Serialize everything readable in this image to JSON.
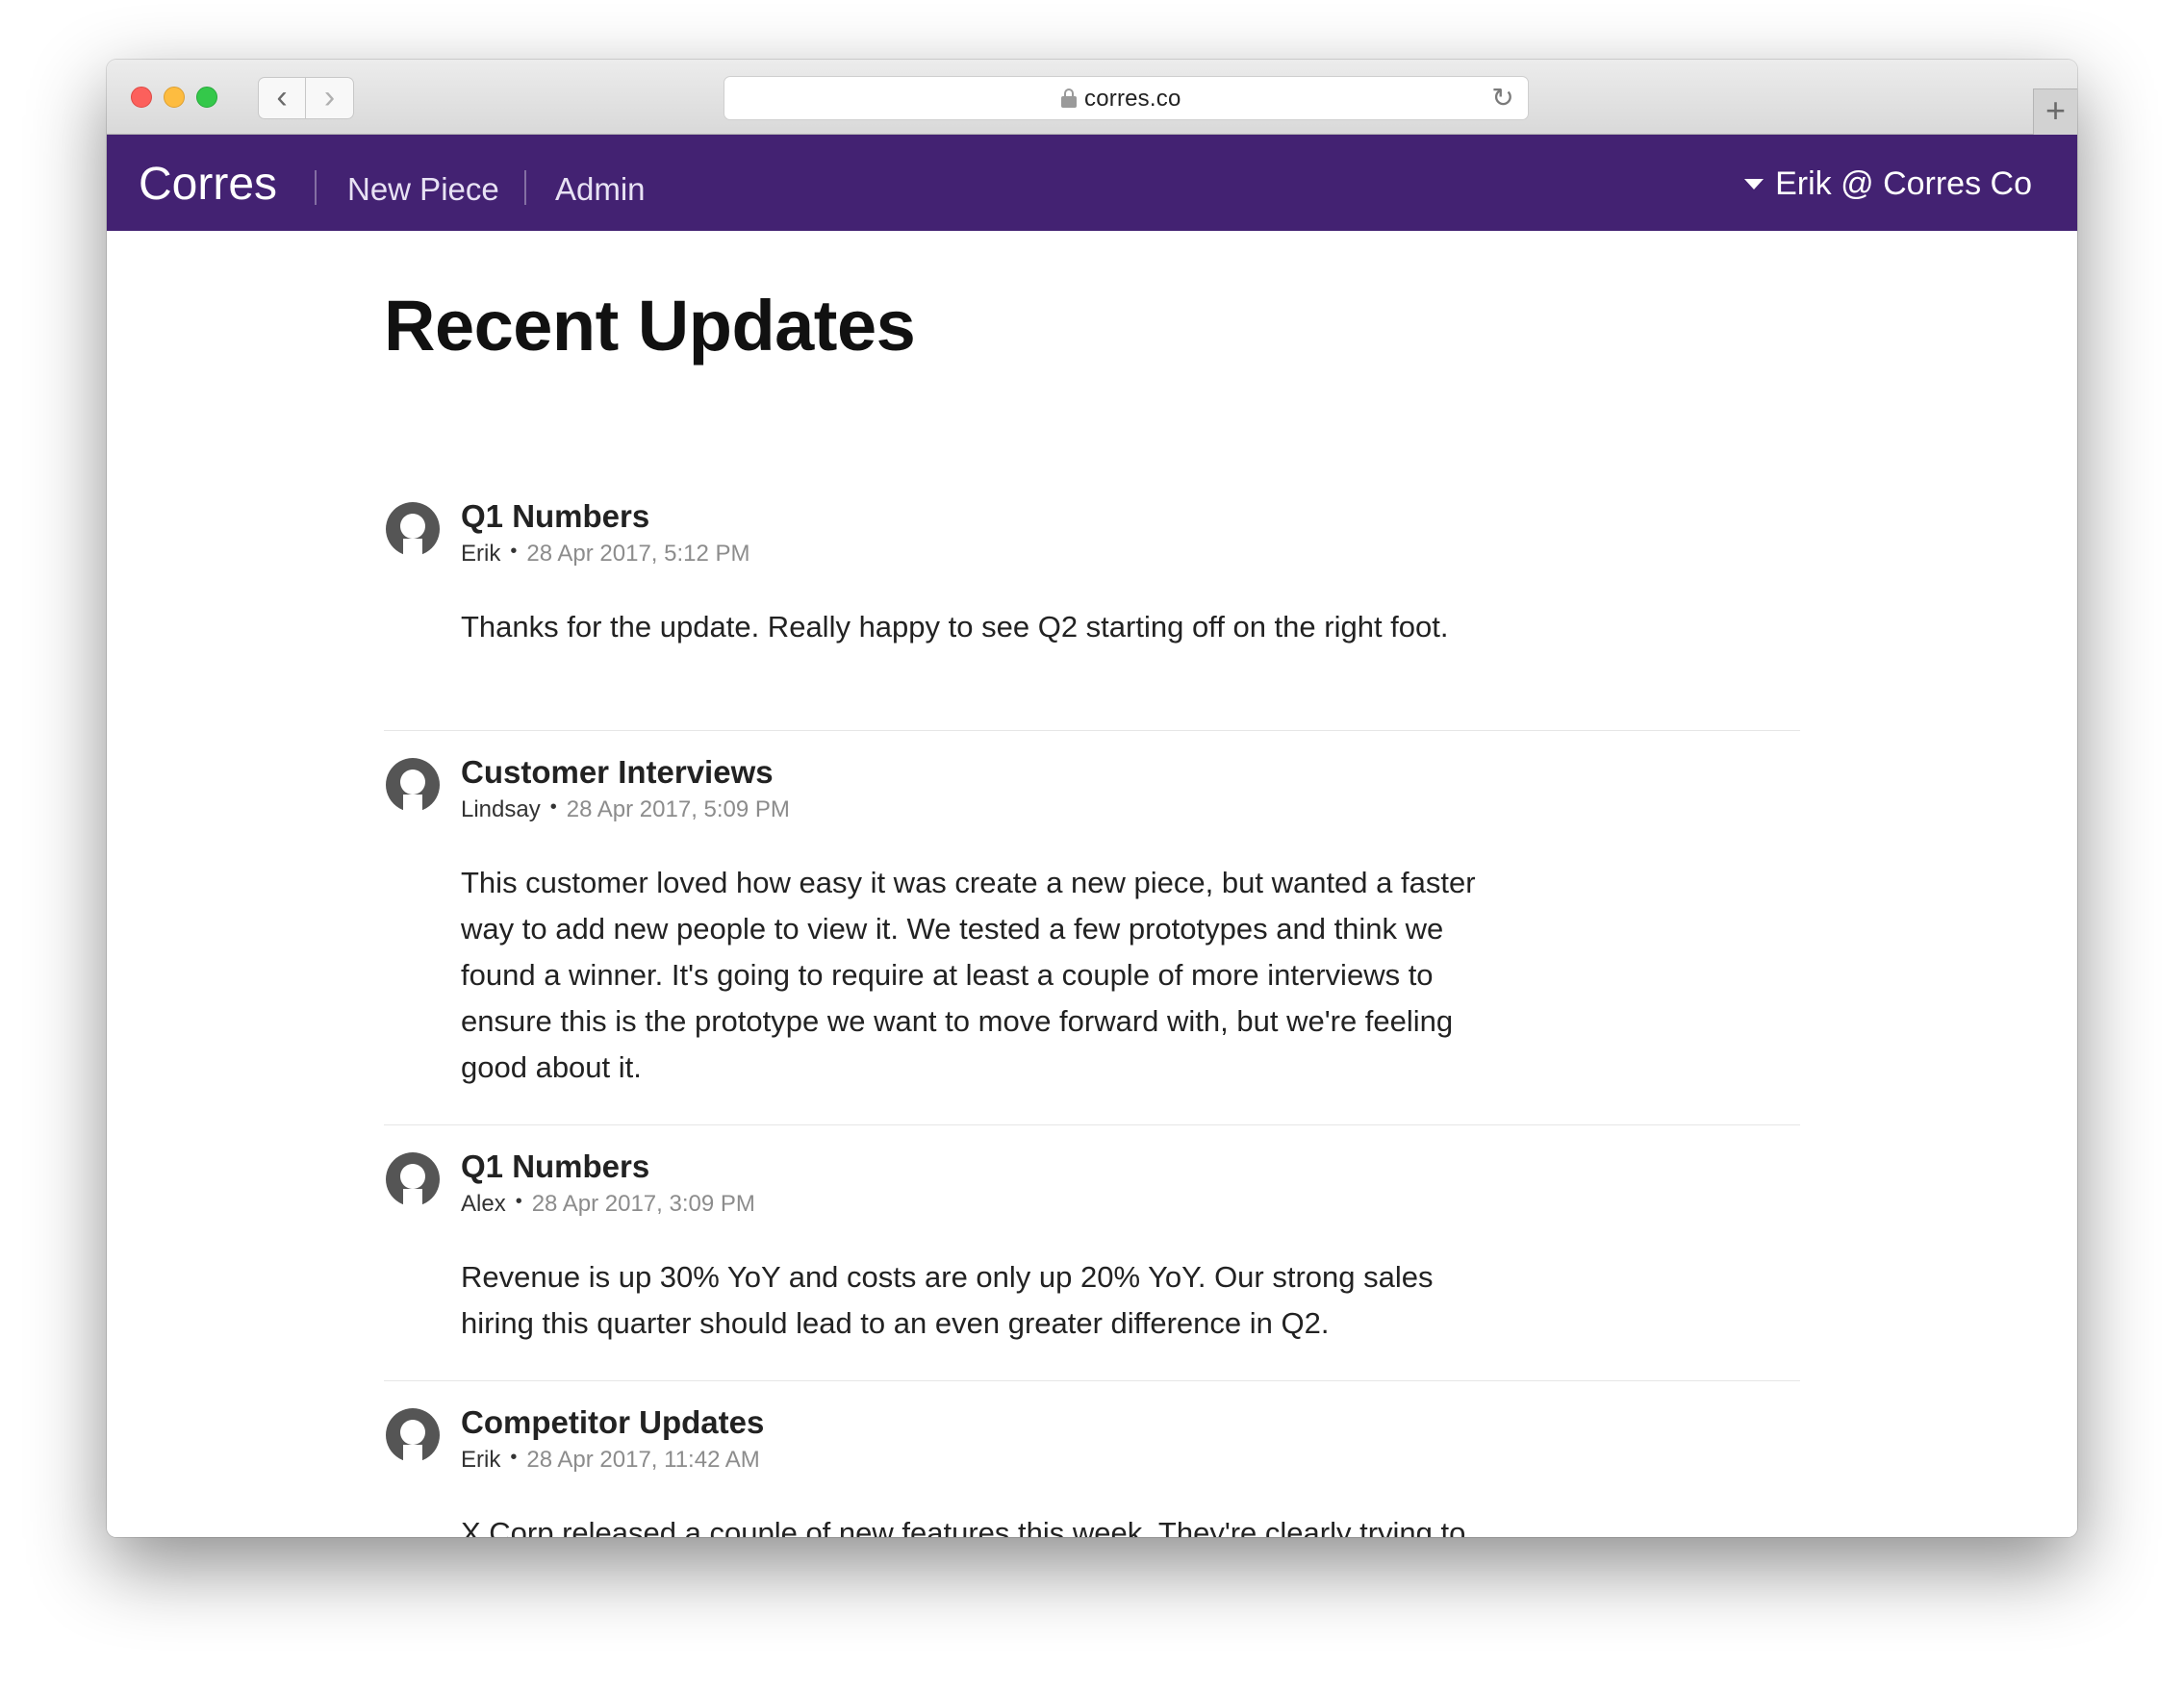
{
  "browser": {
    "url": "corres.co",
    "controls": {
      "close": "close",
      "minimize": "minimize",
      "zoom": "zoom"
    }
  },
  "appbar": {
    "brand": "Corres",
    "nav": [
      "New Piece",
      "Admin"
    ],
    "user_menu": "Erik @ Corres Co",
    "background": "#432272"
  },
  "page": {
    "title": "Recent Updates"
  },
  "updates": [
    {
      "title": "Q1 Numbers",
      "author": "Erik",
      "time": "28 Apr 2017, 5:12 PM",
      "body": "Thanks for the update. Really happy to see Q2 starting off on the right foot."
    },
    {
      "title": "Customer Interviews",
      "author": "Lindsay",
      "time": "28 Apr 2017, 5:09 PM",
      "body": "This customer loved how easy it was create a new piece, but wanted a faster way to add new people to view it. We tested a few prototypes and think we found a winner. It's going to require at least a couple of more interviews to ensure this is the prototype we want to move forward with, but we're feeling good about it."
    },
    {
      "title": "Q1 Numbers",
      "author": "Alex",
      "time": "28 Apr 2017, 3:09 PM",
      "body": "Revenue is up 30% YoY and costs are only up 20% YoY. Our strong sales hiring this quarter should lead to an even greater difference in Q2."
    },
    {
      "title": "Competitor Updates",
      "author": "Erik",
      "time": "28 Apr 2017, 11:42 AM",
      "body": "X Corp released a couple of new features this week. They're clearly trying to catch up to us."
    }
  ]
}
